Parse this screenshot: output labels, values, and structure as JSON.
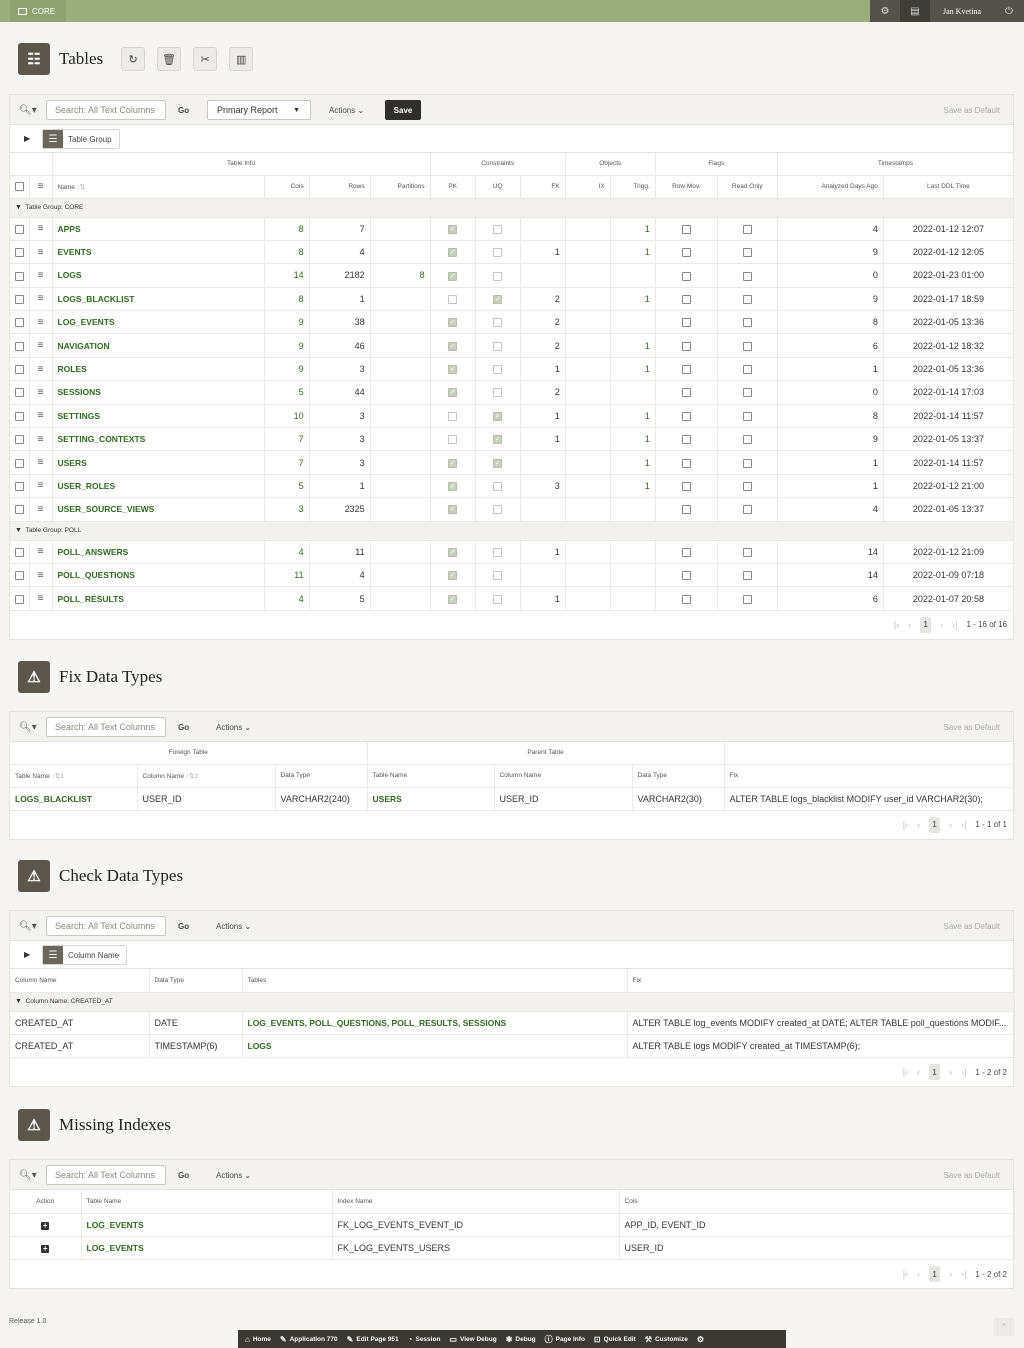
{
  "topbar": {
    "brand": "CORE",
    "user": "Jan Kvetina"
  },
  "tables_section": {
    "title": "Tables",
    "toolbar": {
      "search_placeholder": "Search: All Text Columns",
      "go": "Go",
      "report": "Primary Report",
      "actions": "Actions",
      "save": "Save",
      "save_default": "Save as Default"
    },
    "control_break": "Table Group",
    "group_headers": [
      "Table Info",
      "Constraints",
      "Objects",
      "Flags",
      "Timestamps"
    ],
    "columns": [
      "Name",
      "Cols",
      "Rows",
      "Partitions",
      "PK",
      "UQ",
      "FK",
      "IX",
      "Trigg.",
      "Row Mov.",
      "Read Only",
      "Analyzed Days Ago",
      "Last DDL Time"
    ],
    "groups": [
      {
        "label": "Table Group: CORE",
        "rows": [
          {
            "name": "APPS",
            "cols": "8",
            "rows": "7",
            "partitions": "",
            "pk": true,
            "uq": false,
            "fk": "",
            "ix": "",
            "trigg": "1",
            "analyzed": "4",
            "ddl": "2022-01-12 12:07"
          },
          {
            "name": "EVENTS",
            "cols": "8",
            "rows": "4",
            "partitions": "",
            "pk": true,
            "uq": false,
            "fk": "1",
            "ix": "",
            "trigg": "1",
            "analyzed": "9",
            "ddl": "2022-01-12 12:05"
          },
          {
            "name": "LOGS",
            "cols": "14",
            "rows": "2182",
            "partitions": "8",
            "pk": true,
            "uq": false,
            "fk": "",
            "ix": "",
            "trigg": "",
            "analyzed": "0",
            "ddl": "2022-01-23 01:00"
          },
          {
            "name": "LOGS_BLACKLIST",
            "cols": "8",
            "rows": "1",
            "partitions": "",
            "pk": false,
            "uq": true,
            "fk": "2",
            "ix": "",
            "trigg": "1",
            "analyzed": "9",
            "ddl": "2022-01-17 18:59"
          },
          {
            "name": "LOG_EVENTS",
            "cols": "9",
            "rows": "38",
            "partitions": "",
            "pk": true,
            "uq": false,
            "fk": "2",
            "ix": "",
            "trigg": "",
            "analyzed": "8",
            "ddl": "2022-01-05 13:36"
          },
          {
            "name": "NAVIGATION",
            "cols": "9",
            "rows": "46",
            "partitions": "",
            "pk": true,
            "uq": false,
            "fk": "2",
            "ix": "",
            "trigg": "1",
            "analyzed": "6",
            "ddl": "2022-01-12 18:32"
          },
          {
            "name": "ROLES",
            "cols": "9",
            "rows": "3",
            "partitions": "",
            "pk": true,
            "uq": false,
            "fk": "1",
            "ix": "",
            "trigg": "1",
            "analyzed": "1",
            "ddl": "2022-01-05 13:36"
          },
          {
            "name": "SESSIONS",
            "cols": "5",
            "rows": "44",
            "partitions": "",
            "pk": true,
            "uq": false,
            "fk": "2",
            "ix": "",
            "trigg": "",
            "analyzed": "0",
            "ddl": "2022-01-14 17:03"
          },
          {
            "name": "SETTINGS",
            "cols": "10",
            "rows": "3",
            "partitions": "",
            "pk": false,
            "uq": true,
            "fk": "1",
            "ix": "",
            "trigg": "1",
            "analyzed": "8",
            "ddl": "2022-01-14 11:57"
          },
          {
            "name": "SETTING_CONTEXTS",
            "cols": "7",
            "rows": "3",
            "partitions": "",
            "pk": false,
            "uq": true,
            "fk": "1",
            "ix": "",
            "trigg": "1",
            "analyzed": "9",
            "ddl": "2022-01-05 13:37"
          },
          {
            "name": "USERS",
            "cols": "7",
            "rows": "3",
            "partitions": "",
            "pk": true,
            "uq": true,
            "fk": "",
            "ix": "",
            "trigg": "1",
            "analyzed": "1",
            "ddl": "2022-01-14 11:57"
          },
          {
            "name": "USER_ROLES",
            "cols": "5",
            "rows": "1",
            "partitions": "",
            "pk": true,
            "uq": false,
            "fk": "3",
            "ix": "",
            "trigg": "1",
            "analyzed": "1",
            "ddl": "2022-01-12 21:00"
          },
          {
            "name": "USER_SOURCE_VIEWS",
            "cols": "3",
            "rows": "2325",
            "partitions": "",
            "pk": true,
            "uq": false,
            "fk": "",
            "ix": "",
            "trigg": "",
            "analyzed": "4",
            "ddl": "2022-01-05 13:37"
          }
        ]
      },
      {
        "label": "Table Group: POLL",
        "rows": [
          {
            "name": "POLL_ANSWERS",
            "cols": "4",
            "rows": "11",
            "partitions": "",
            "pk": true,
            "uq": false,
            "fk": "1",
            "ix": "",
            "trigg": "",
            "analyzed": "14",
            "ddl": "2022-01-12 21:09"
          },
          {
            "name": "POLL_QUESTIONS",
            "cols": "11",
            "rows": "4",
            "partitions": "",
            "pk": true,
            "uq": false,
            "fk": "",
            "ix": "",
            "trigg": "",
            "analyzed": "14",
            "ddl": "2022-01-09 07:18"
          },
          {
            "name": "POLL_RESULTS",
            "cols": "4",
            "rows": "5",
            "partitions": "",
            "pk": true,
            "uq": false,
            "fk": "1",
            "ix": "",
            "trigg": "",
            "analyzed": "6",
            "ddl": "2022-01-07 20:58"
          }
        ]
      }
    ],
    "pagination": {
      "page": "1",
      "count": "1 - 16 of 16"
    }
  },
  "fix_section": {
    "title": "Fix Data Types",
    "toolbar": {
      "search_placeholder": "Search: All Text Columns",
      "go": "Go",
      "actions": "Actions",
      "save_default": "Save as Default"
    },
    "group_headers": [
      "Foreign Table",
      "Parent Table"
    ],
    "columns": [
      "Table Name",
      "Column Name",
      "Data Type",
      "Table Name",
      "Column Name",
      "Data Type",
      "Fix"
    ],
    "rows": [
      {
        "ft": "LOGS_BLACKLIST",
        "fc": "USER_ID",
        "fd": "VARCHAR2(240)",
        "pt": "USERS",
        "pc": "USER_ID",
        "pd": "VARCHAR2(30)",
        "fix": "ALTER TABLE logs_blacklist MODIFY user_id VARCHAR2(30);"
      }
    ],
    "pagination": {
      "page": "1",
      "count": "1 - 1 of 1"
    }
  },
  "check_section": {
    "title": "Check Data Types",
    "toolbar": {
      "search_placeholder": "Search: All Text Columns",
      "go": "Go",
      "actions": "Actions",
      "save_default": "Save as Default"
    },
    "control_break": "Column Name",
    "columns": [
      "Column Name",
      "Data Type",
      "Tables",
      "Fix"
    ],
    "group_label": "Column Name: CREATED_AT",
    "rows": [
      {
        "col": "CREATED_AT",
        "type": "DATE",
        "tables": "LOG_EVENTS, POLL_QUESTIONS, POLL_RESULTS, SESSIONS",
        "fix": "ALTER TABLE log_events MODIFY created_at DATE; ALTER TABLE poll_questions MODIF..."
      },
      {
        "col": "CREATED_AT",
        "type": "TIMESTAMP(6)",
        "tables": "LOGS",
        "fix": "ALTER TABLE logs MODIFY created_at TIMESTAMP(6);"
      }
    ],
    "pagination": {
      "page": "1",
      "count": "1 - 2 of 2"
    }
  },
  "missing_section": {
    "title": "Missing Indexes",
    "toolbar": {
      "search_placeholder": "Search: All Text Columns",
      "go": "Go",
      "actions": "Actions",
      "save_default": "Save as Default"
    },
    "columns": [
      "Action",
      "Table Name",
      "Index Name",
      "Cols"
    ],
    "rows": [
      {
        "table": "LOG_EVENTS",
        "index": "FK_LOG_EVENTS_EVENT_ID",
        "cols": "APP_ID, EVENT_ID"
      },
      {
        "table": "LOG_EVENTS",
        "index": "FK_LOG_EVENTS_USERS",
        "cols": "USER_ID"
      }
    ],
    "pagination": {
      "page": "1",
      "count": "1 - 2 of 2"
    }
  },
  "footer": {
    "release": "Release 1.0",
    "devbar": [
      "Home",
      "Application 770",
      "Edit Page 951",
      "Session",
      "View Debug",
      "Debug",
      "Page Info",
      "Quick Edit",
      "Customize"
    ]
  },
  "colors": {
    "topbar": "#9aae7c",
    "link": "#2f6a1f",
    "icon_bg": "#5b574d"
  }
}
